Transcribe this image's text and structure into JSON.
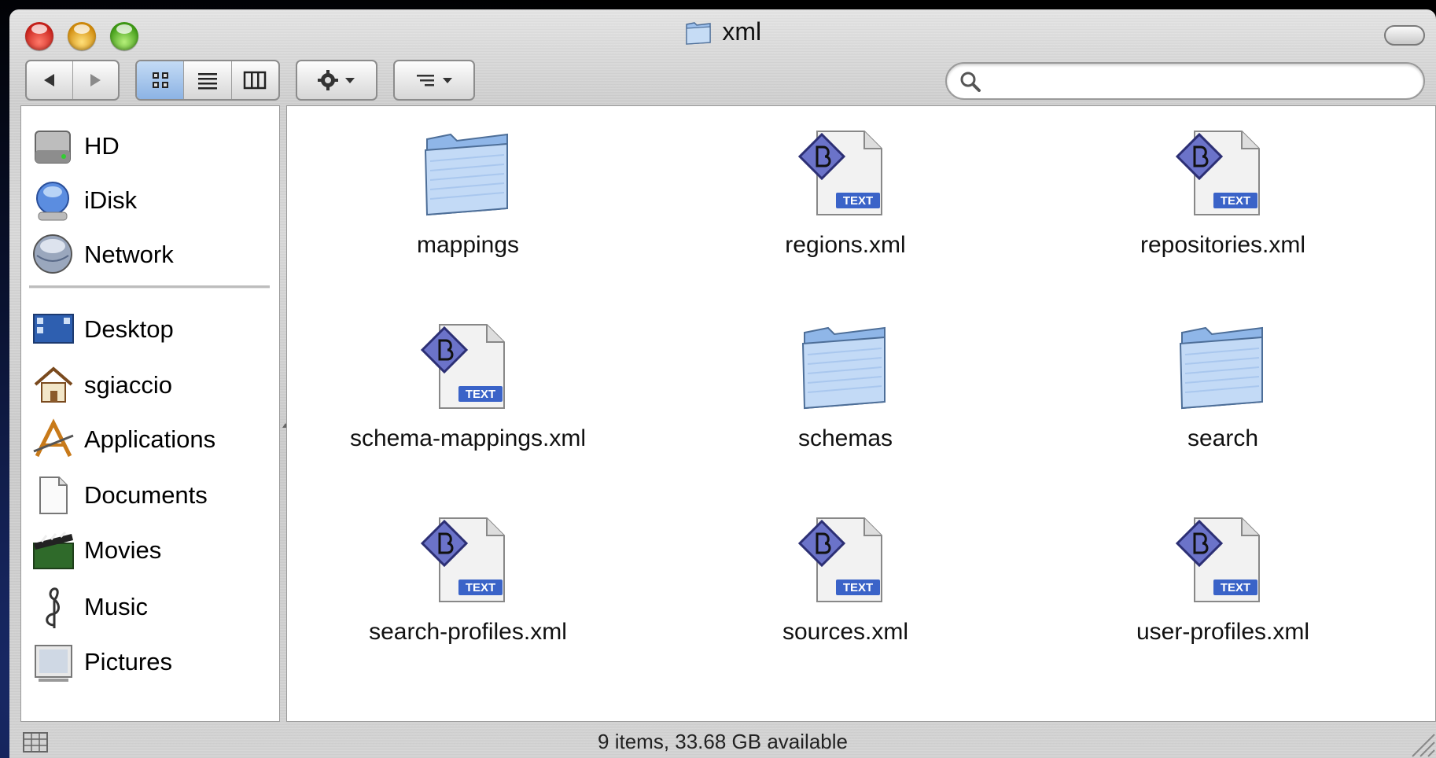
{
  "window": {
    "title": "xml"
  },
  "search": {
    "value": "",
    "placeholder": ""
  },
  "sidebar": {
    "devices": [
      {
        "label": "HD",
        "icon": "hard-drive-icon"
      },
      {
        "label": "iDisk",
        "icon": "idisk-icon"
      },
      {
        "label": "Network",
        "icon": "network-icon"
      }
    ],
    "places": [
      {
        "label": "Desktop",
        "icon": "desktop-icon"
      },
      {
        "label": "sgiaccio",
        "icon": "home-icon"
      },
      {
        "label": "Applications",
        "icon": "applications-icon"
      },
      {
        "label": "Documents",
        "icon": "documents-icon"
      },
      {
        "label": "Movies",
        "icon": "movies-icon"
      },
      {
        "label": "Music",
        "icon": "music-icon"
      },
      {
        "label": "Pictures",
        "icon": "pictures-icon"
      }
    ]
  },
  "files": [
    {
      "name": "mappings",
      "kind": "folder"
    },
    {
      "name": "regions.xml",
      "kind": "bbedit-text"
    },
    {
      "name": "repositories.xml",
      "kind": "bbedit-text"
    },
    {
      "name": "schema-mappings.xml",
      "kind": "bbedit-text"
    },
    {
      "name": "schemas",
      "kind": "folder"
    },
    {
      "name": "search",
      "kind": "folder"
    },
    {
      "name": "search-profiles.xml",
      "kind": "bbedit-text"
    },
    {
      "name": "sources.xml",
      "kind": "bbedit-text"
    },
    {
      "name": "user-profiles.xml",
      "kind": "bbedit-text"
    }
  ],
  "file_badge": "TEXT",
  "status": {
    "text": "9 items, 33.68 GB available"
  },
  "colors": {
    "folder": "#8fb6e8",
    "badge": "#3a63c8",
    "selected_view": "#a9c7ee"
  }
}
